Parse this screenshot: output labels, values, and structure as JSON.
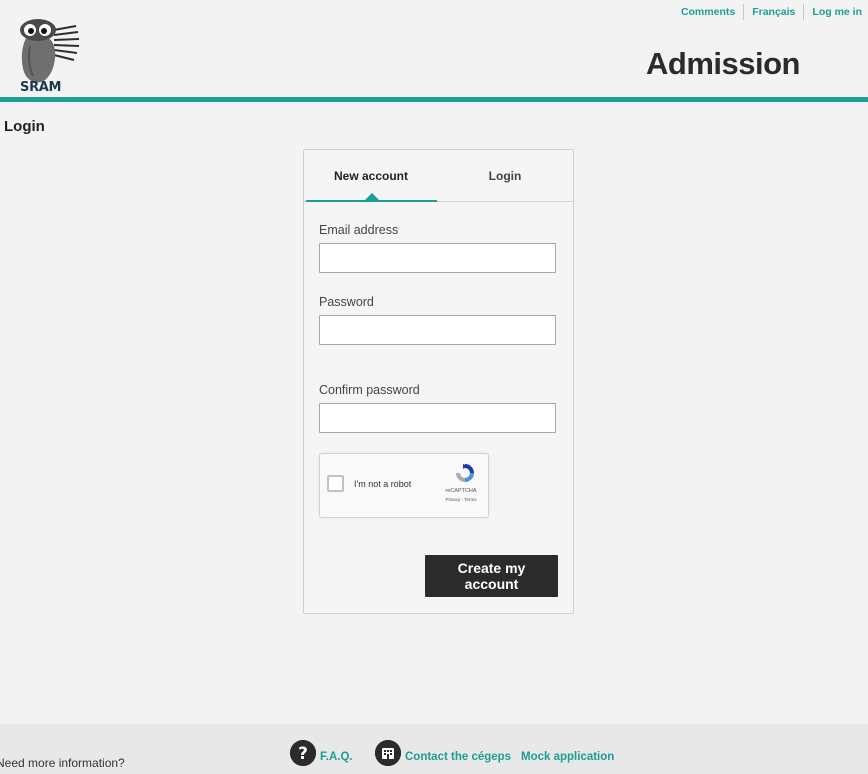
{
  "header": {
    "logo_text": "SRAM",
    "title": "Admission",
    "links": [
      "Comments",
      "Français",
      "Log me in"
    ]
  },
  "page": {
    "title": "Login"
  },
  "tabs": [
    {
      "label": "New account",
      "active": true
    },
    {
      "label": "Login",
      "active": false
    }
  ],
  "form": {
    "email_label": "Email address",
    "email_value": "",
    "password_label": "Password",
    "password_value": "",
    "confirm_label": "Confirm password",
    "confirm_value": "",
    "submit_label": "Create my account"
  },
  "recaptcha": {
    "label": "I'm not a robot",
    "brand": "reCAPTCHA",
    "terms": "Privacy - Terms"
  },
  "footer": {
    "text": "Need more information?",
    "links": [
      "F.A.Q.",
      "Contact the cégeps",
      "Mock application"
    ]
  },
  "colors": {
    "accent": "#1a9f94",
    "dark": "#2b2b2b",
    "background": "#f3f3f3"
  },
  "icons": {
    "faq": "question-circle-icon",
    "contact": "building-circle-icon",
    "logo": "owl-logo-icon",
    "recaptcha": "recaptcha-logo-icon"
  }
}
